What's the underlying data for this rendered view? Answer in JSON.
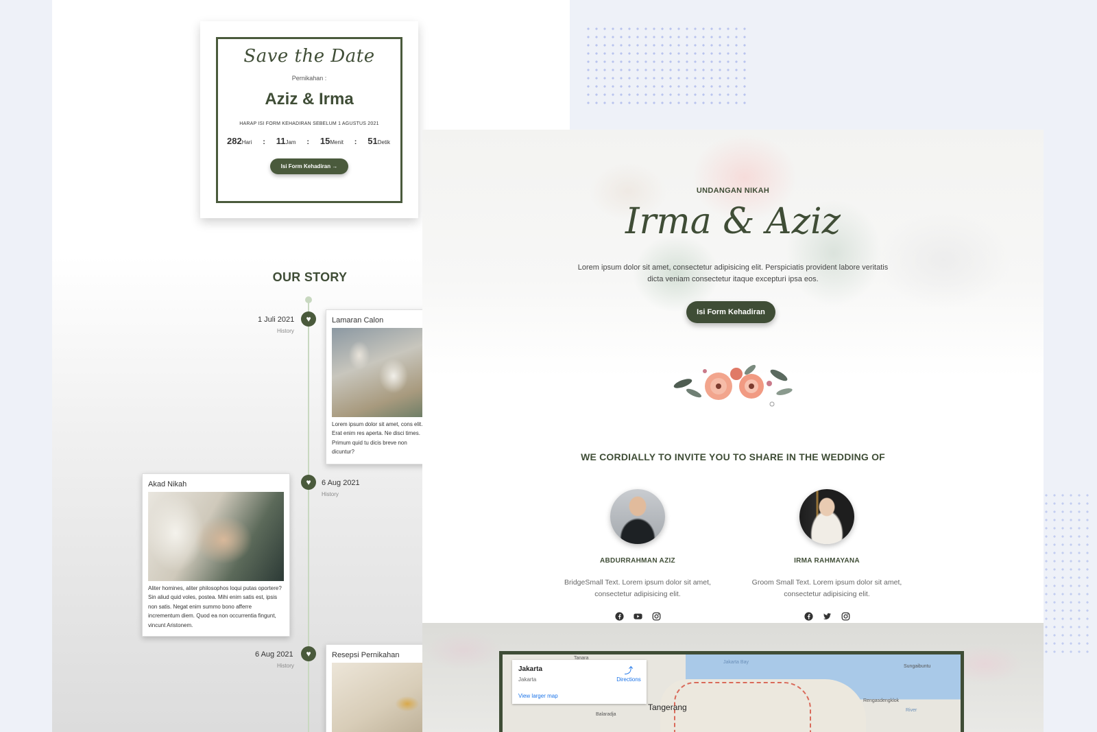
{
  "save_the_date": {
    "title": "Save the Date",
    "subtitle": "Pernikahan :",
    "names": "Aziz & Irma",
    "note": "HARAP ISI FORM KEHADIRAN SEBELUM 1 AGUSTUS 2021",
    "countdown": [
      {
        "value": "282",
        "unit": "Hari"
      },
      {
        "value": "11",
        "unit": "Jam"
      },
      {
        "value": "15",
        "unit": "Menit"
      },
      {
        "value": "51",
        "unit": "Detik"
      }
    ],
    "separator": ":",
    "button": "Isi Form Kehadiran →"
  },
  "story": {
    "title": "OUR STORY",
    "events": [
      {
        "date": "1 Juli 2021",
        "tag": "History",
        "title": "Lamaran Calon",
        "text": "Lorem ipsum dolor sit amet, cons elit. Erat enim res aperta. Ne disci times. Primum quid tu dicis breve non dicuntur?"
      },
      {
        "date": "6 Aug 2021",
        "tag": "History",
        "title": "Akad Nikah",
        "text": "Aliter homines, aliter philosophos loqui putas oportere? Sin aliud quid voles, postea. Mihi enim satis est, ipsis non satis. Negat enim summo bono afferre incrementum diem. Quod ea non occurrentia fingunt, vincunt Aristonem."
      },
      {
        "date": "6 Aug 2021",
        "tag": "History",
        "title": "Resepsi Pernikahan",
        "text": ""
      }
    ]
  },
  "hero": {
    "eyebrow": "UNDANGAN NIKAH",
    "names": "Irma & Aziz",
    "lead": "Lorem ipsum dolor sit amet, consectetur adipisicing elit. Perspiciatis provident labore veritatis dicta veniam consectetur itaque excepturi ipsa eos.",
    "button": "Isi Form Kehadiran"
  },
  "couple": {
    "title": "WE CORDIALLY TO INVITE YOU TO SHARE IN THE WEDDING OF",
    "groom": {
      "name": "ABDURRAHMAN AZIZ",
      "bio": "BridgeSmall Text. Lorem ipsum dolor sit amet, consectetur adipisicing elit.",
      "socials": [
        "facebook-icon",
        "youtube-icon",
        "instagram-icon"
      ]
    },
    "bride": {
      "name": "IRMA RAHMAYANA",
      "bio": "Groom Small Text. Lorem ipsum dolor sit amet, consectetur adipisicing elit.",
      "socials": [
        "facebook-icon",
        "twitter-icon",
        "instagram-icon"
      ]
    }
  },
  "map": {
    "place_title": "Jakarta",
    "place_sub": "Jakarta",
    "directions": "Directions",
    "larger_map": "View larger map",
    "labels": {
      "tangerang": "Tangerang",
      "jakarta_bay": "Jakarta Bay",
      "sungaibuntu": "Sungaibuntu",
      "rengasdengklok": "Rengasdengklok",
      "balaraja": "Balaradja",
      "tanara": "Tanara",
      "river": "River"
    }
  },
  "colors": {
    "accent": "#3f4d36",
    "background": "#eef1f8",
    "dots": "#b9c4ee"
  }
}
